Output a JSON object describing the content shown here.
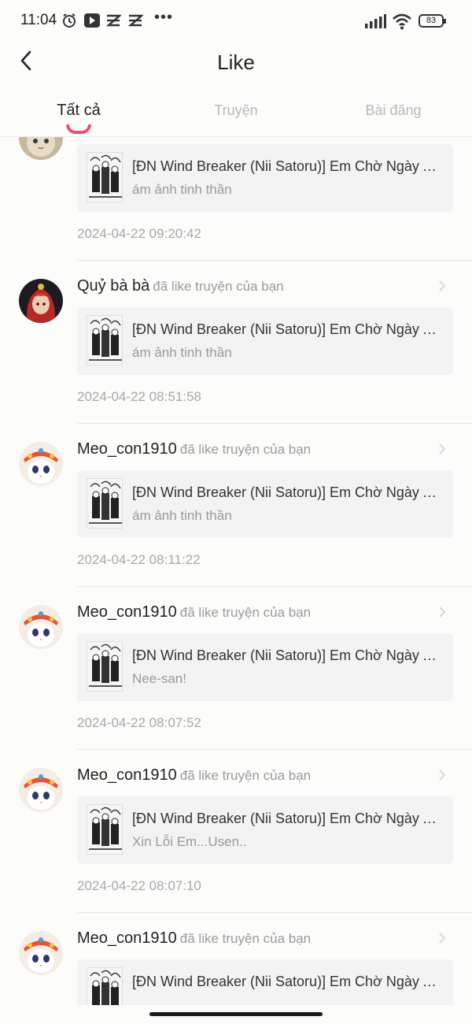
{
  "status_bar": {
    "time": "11:04",
    "battery": "83"
  },
  "header": {
    "title": "Like"
  },
  "tabs": [
    {
      "label": "Tất cả",
      "active": true
    },
    {
      "label": "Truyện",
      "active": false
    },
    {
      "label": "Bài đăng",
      "active": false
    }
  ],
  "notifications": [
    {
      "user": "",
      "action": "",
      "story_title": "[ĐN Wind Breaker (Nii Satoru)] Em Chờ Ngày Anh Nhớ Đến Em",
      "chapter": "ám ảnh tinh thần",
      "time": "2024-04-22 09:20:42",
      "avatar": "cat-avatar"
    },
    {
      "user": "Quỷ bà bà",
      "action": "đã like truyện của bạn",
      "story_title": "[ĐN Wind Breaker (Nii Satoru)] Em Chờ Ngày Anh Nhớ Đến Em",
      "chapter": "ám ảnh tinh thần",
      "time": "2024-04-22 08:51:58",
      "avatar": "red-hair-avatar"
    },
    {
      "user": "Meo_con1910",
      "action": "đã like truyện của bạn",
      "story_title": "[ĐN Wind Breaker (Nii Satoru)] Em Chờ Ngày Anh Nhớ Đến Em",
      "chapter": "ám ảnh tinh thần",
      "time": "2024-04-22 08:11:22",
      "avatar": "kitten-avatar"
    },
    {
      "user": "Meo_con1910",
      "action": "đã like truyện của bạn",
      "story_title": "[ĐN Wind Breaker (Nii Satoru)] Em Chờ Ngày Anh Nhớ Đến Em",
      "chapter": "Nee-san!",
      "time": "2024-04-22 08:07:52",
      "avatar": "kitten-avatar"
    },
    {
      "user": "Meo_con1910",
      "action": "đã like truyện của bạn",
      "story_title": "[ĐN Wind Breaker (Nii Satoru)] Em Chờ Ngày Anh Nhớ Đến Em",
      "chapter": "Xin Lỗi Em...Usen..",
      "time": "2024-04-22 08:07:10",
      "avatar": "kitten-avatar"
    },
    {
      "user": "Meo_con1910",
      "action": "đã like truyện của bạn",
      "story_title": "[ĐN Wind Breaker (Nii Satoru)] Em Chờ Ngày Anh Nhớ Đến Em",
      "chapter": "",
      "time": "",
      "avatar": "kitten-avatar"
    }
  ],
  "colors": {
    "accent": "#f0506e",
    "card_bg": "#f3f3f3",
    "muted_text": "#9a9a9a"
  }
}
